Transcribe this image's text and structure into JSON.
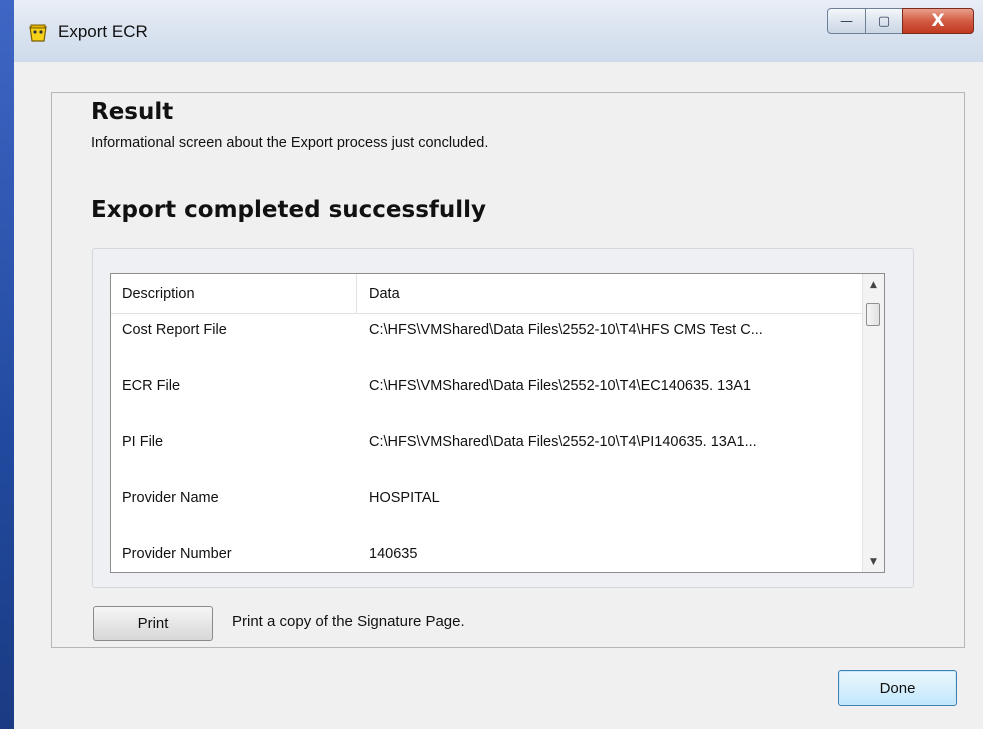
{
  "window": {
    "title": "Export ECR",
    "controls": {
      "minimize": "—",
      "maximize": "▢",
      "close": "X"
    }
  },
  "result": {
    "heading": "Result",
    "subtitle": "Informational screen about the Export process just concluded.",
    "status": "Export completed successfully"
  },
  "table": {
    "columns": {
      "description": "Description",
      "data": "Data"
    },
    "rows": [
      {
        "description": "Cost Report File",
        "data": "C:\\HFS\\VMShared\\Data Files\\2552-10\\T4\\HFS CMS Test C..."
      },
      {
        "description": "ECR File",
        "data": "C:\\HFS\\VMShared\\Data Files\\2552-10\\T4\\EC140635. 13A1"
      },
      {
        "description": "PI File",
        "data": "C:\\HFS\\VMShared\\Data Files\\2552-10\\T4\\PI140635. 13A1..."
      },
      {
        "description": "Provider Name",
        "data": "HOSPITAL"
      },
      {
        "description": "Provider Number",
        "data": "140635"
      }
    ],
    "scroll": {
      "up": "▲",
      "down": "▼"
    }
  },
  "print": {
    "button_label": "Print",
    "description": "Print a copy of the Signature Page."
  },
  "done": {
    "button_label": "Done"
  },
  "colors": {
    "titlebar": "#dbe4f0",
    "client": "#f0f0f0",
    "close": "#c0391f",
    "done_border": "#3c7fb1"
  }
}
